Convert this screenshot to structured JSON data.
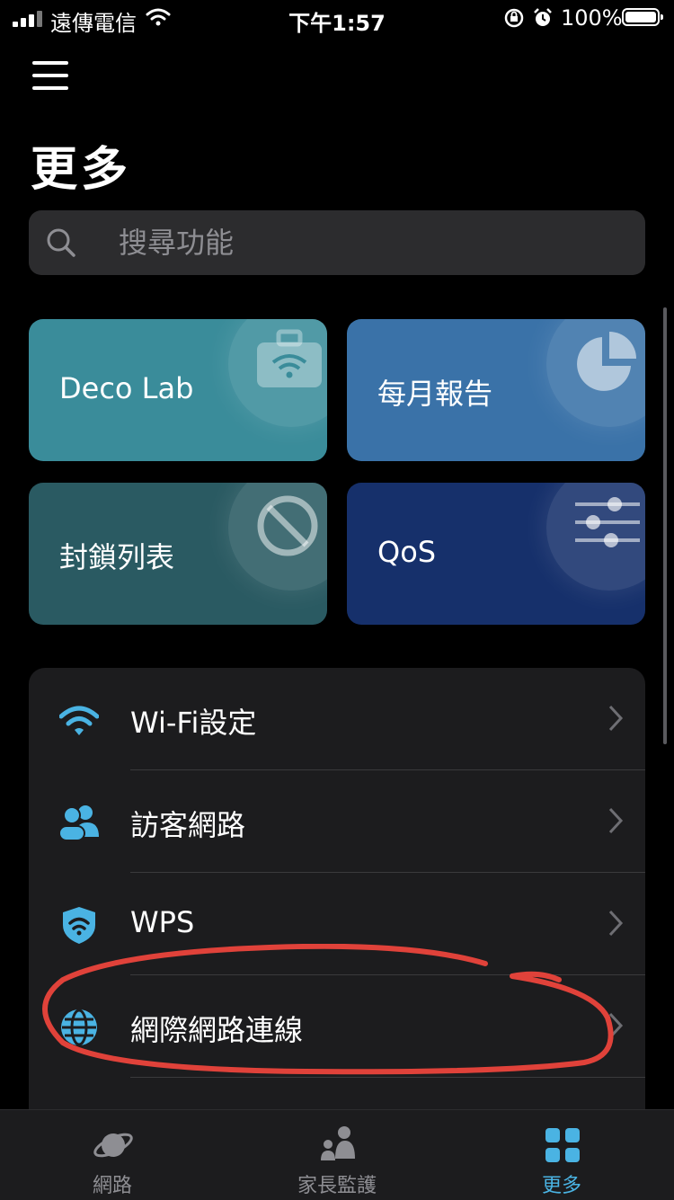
{
  "status_bar": {
    "carrier": "遠傳電信",
    "time": "下午1:57",
    "battery": "100%"
  },
  "header": {
    "title": "更多"
  },
  "search": {
    "placeholder": "搜尋功能"
  },
  "tiles": [
    {
      "label": "Deco Lab",
      "icon": "toolbox-wifi-icon",
      "color": "#3a8c9a"
    },
    {
      "label": "每月報告",
      "icon": "pie-chart-icon",
      "color": "#3a72a8"
    },
    {
      "label": "封鎖列表",
      "icon": "block-icon",
      "color": "#2a5a62"
    },
    {
      "label": "QoS",
      "icon": "sliders-icon",
      "color": "#16306b"
    }
  ],
  "list": [
    {
      "label": "Wi-Fi設定",
      "icon": "wifi-icon"
    },
    {
      "label": "訪客網路",
      "icon": "guests-icon"
    },
    {
      "label": "WPS",
      "icon": "wps-shield-icon"
    },
    {
      "label": "網際網路連線",
      "icon": "globe-icon"
    }
  ],
  "tabs": [
    {
      "label": "網路",
      "icon": "planet-icon",
      "active": false
    },
    {
      "label": "家長監護",
      "icon": "family-icon",
      "active": false
    },
    {
      "label": "更多",
      "icon": "grid-icon",
      "active": true
    }
  ],
  "colors": {
    "accent": "#4ab3e3",
    "annotation": "#e0423a"
  }
}
